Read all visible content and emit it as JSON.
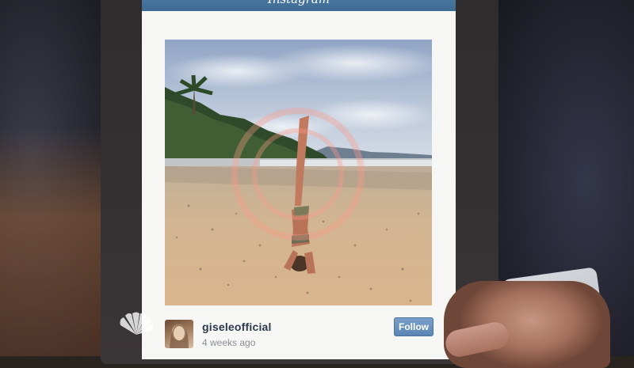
{
  "instagram": {
    "app_title": "Instagram",
    "username": "giseleofficial",
    "timestamp": "4 weeks ago",
    "follow_label": "Follow"
  },
  "colors": {
    "header_bar": "#4a7aa3",
    "follow_button": "#6a93c0",
    "username_text": "#2c3a4a",
    "timestamp_text": "#8a8f96"
  },
  "icons": {
    "broadcast_logo": "nbc-peacock-icon"
  }
}
